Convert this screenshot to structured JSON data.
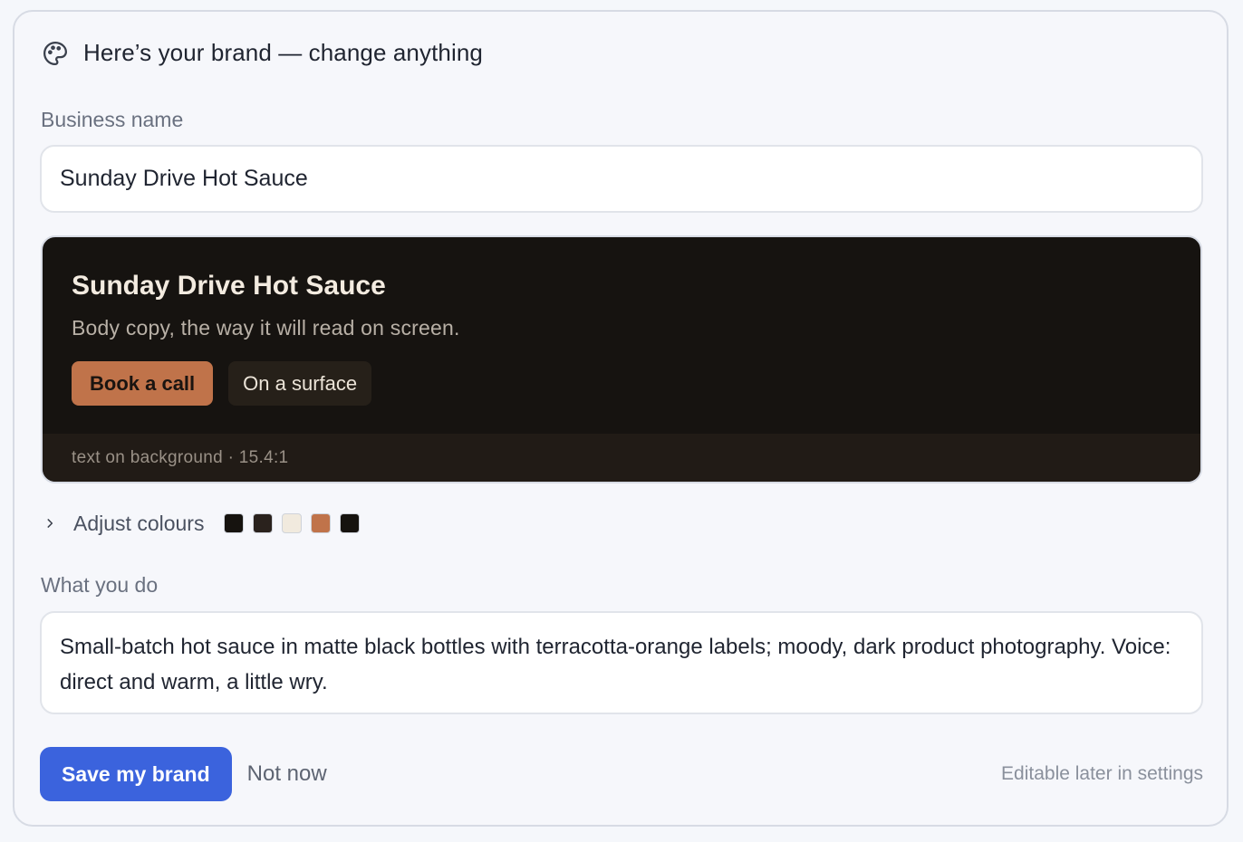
{
  "header": {
    "title": "Here’s your brand — change anything",
    "icon": "palette-icon"
  },
  "business_name": {
    "label": "Business name",
    "value": "Sunday Drive Hot Sauce"
  },
  "preview": {
    "title": "Sunday Drive Hot Sauce",
    "body": "Body copy, the way it will read on screen.",
    "primary_button": "Book a call",
    "surface_button": "On a surface",
    "contrast_note": "text on background · 15.4:1"
  },
  "adjust_colours": {
    "label": "Adjust colours",
    "icon": "chevron-right-icon",
    "swatches": [
      "#16130f",
      "#2a221d",
      "#f1eade",
      "#c0734a",
      "#16130f"
    ]
  },
  "what_you_do": {
    "label": "What you do",
    "value": "Small-batch hot sauce in matte black bottles with terracotta-orange labels; moody, dark product photography. Voice: direct and warm, a little wry."
  },
  "actions": {
    "save_label": "Save my brand",
    "dismiss_label": "Not now",
    "note": "Editable later in settings"
  },
  "colors": {
    "accent": "#3b63dd",
    "preview_background": "#161310",
    "preview_primary": "#c0734a"
  }
}
